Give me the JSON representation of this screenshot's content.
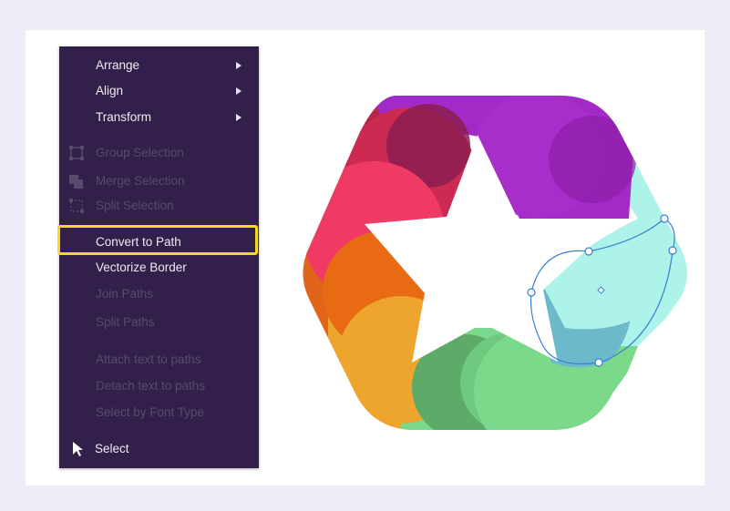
{
  "context_menu": {
    "items": [
      {
        "label": "Arrange",
        "enabled": true,
        "submenu": true
      },
      {
        "label": "Align",
        "enabled": true,
        "submenu": true
      },
      {
        "label": "Transform",
        "enabled": true,
        "submenu": true
      },
      {
        "label": "Group Selection",
        "enabled": false,
        "icon": "group-selection-icon"
      },
      {
        "label": "Merge Selection",
        "enabled": false,
        "icon": "merge-selection-icon"
      },
      {
        "label": "Split Selection",
        "enabled": false,
        "icon": "split-selection-icon"
      },
      {
        "label": "Convert to Path",
        "enabled": true,
        "highlighted": true
      },
      {
        "label": "Vectorize Border",
        "enabled": true
      },
      {
        "label": "Join Paths",
        "enabled": false
      },
      {
        "label": "Split Paths",
        "enabled": false
      },
      {
        "label": "Attach text to paths",
        "enabled": false
      },
      {
        "label": "Detach text to paths",
        "enabled": false
      },
      {
        "label": "Select by Font Type",
        "enabled": false
      },
      {
        "label": "Select",
        "enabled": true,
        "icon": "cursor-arrow-icon"
      }
    ]
  },
  "colors": {
    "menu_background": "#33204a",
    "highlight": "#f5d91e",
    "selection": "#3b7fd0",
    "purple": "#a22bc8",
    "crimson": "#c02749",
    "pink": "#ef3b63",
    "orange": "#e86a12",
    "amber": "#eea52d",
    "green": "#7bd98b",
    "teal": "#aef3ea",
    "blue_teal": "#6cb9cb"
  }
}
